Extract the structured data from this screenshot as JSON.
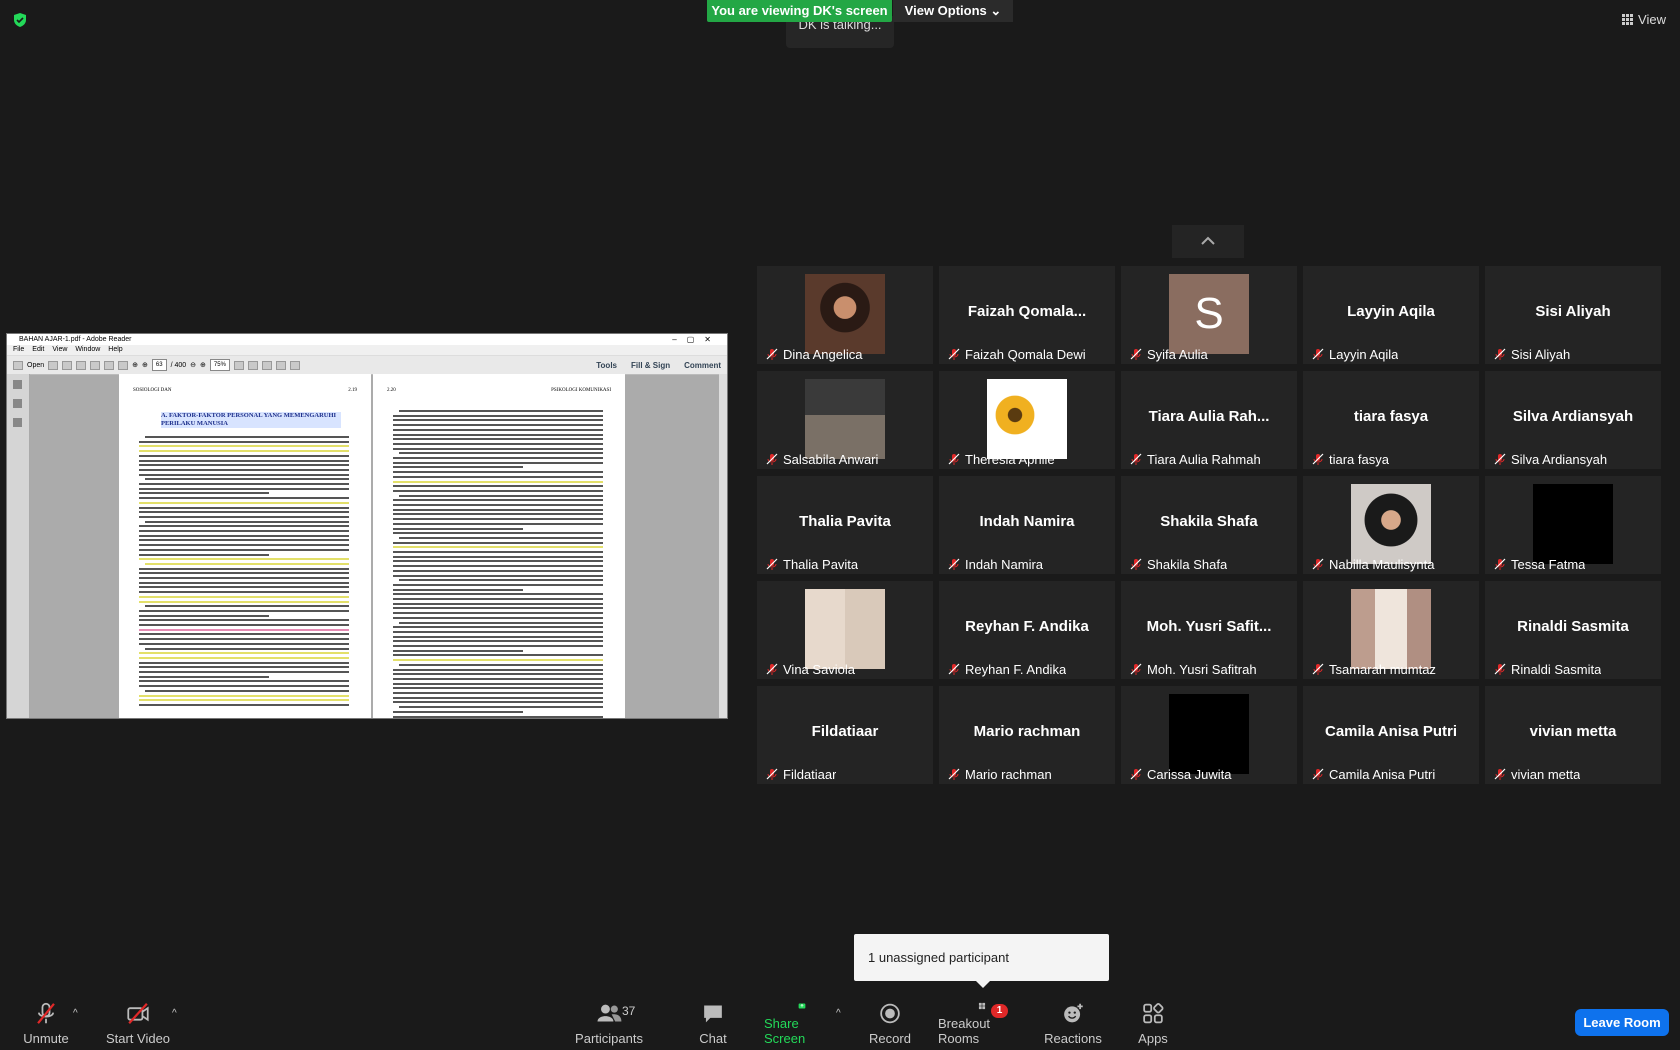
{
  "top": {
    "viewing_banner": "You are viewing DK's screen",
    "view_options": "View Options",
    "talking": "DK is talking...",
    "view_label": "View"
  },
  "pdf": {
    "title": "BAHAN AJAR-1.pdf - Adobe Reader",
    "menu": [
      "File",
      "Edit",
      "View",
      "Window",
      "Help"
    ],
    "open_label": "Open",
    "page_current": "63",
    "page_total": "/ 400",
    "zoom": "75%",
    "tools": "Tools",
    "fill_sign": "Fill & Sign",
    "comment": "Comment",
    "left_page_header": "SOSIOLOGI DAN",
    "left_page_number": "2.19",
    "right_page_number": "2.20",
    "right_page_header": "PSIKOLOGI KOMUNIKASI",
    "heading": "A. FAKTOR-FAKTOR PERSONAL YANG MEMENGARUHI PERILAKU MANUSIA"
  },
  "participants": [
    {
      "name": "Dina Angelica",
      "display": "",
      "avatar": "photo-woman"
    },
    {
      "name": "Faizah Qomala Dewi",
      "display": "Faizah Qomala...",
      "avatar": ""
    },
    {
      "name": "Syifa Aulia",
      "display": "",
      "avatar": "letter",
      "letter": "S"
    },
    {
      "name": "Layyin Aqila",
      "display": "Layyin Aqila",
      "avatar": ""
    },
    {
      "name": "Sisi Aliyah",
      "display": "Sisi Aliyah",
      "avatar": ""
    },
    {
      "name": "Salsabila Anwari",
      "display": "",
      "avatar": "photo-street"
    },
    {
      "name": "Theresia Aprilie",
      "display": "",
      "avatar": "photo-sunflower"
    },
    {
      "name": "Tiara Aulia Rahmah",
      "display": "Tiara Aulia Rah...",
      "avatar": ""
    },
    {
      "name": "tiara fasya",
      "display": "tiara fasya",
      "avatar": ""
    },
    {
      "name": "Silva Ardiansyah",
      "display": "Silva Ardiansyah",
      "avatar": ""
    },
    {
      "name": "Thalia Pavita",
      "display": "Thalia Pavita",
      "avatar": ""
    },
    {
      "name": "Indah Namira",
      "display": "Indah Namira",
      "avatar": ""
    },
    {
      "name": "Shakila Shafa",
      "display": "Shakila Shafa",
      "avatar": ""
    },
    {
      "name": "Nabilla Maulisynta",
      "display": "",
      "avatar": "photo-hijab"
    },
    {
      "name": "Tessa Fatma",
      "display": "",
      "avatar": "black"
    },
    {
      "name": "Vina Saviola",
      "display": "",
      "avatar": "photo-collage"
    },
    {
      "name": "Reyhan F. Andika",
      "display": "Reyhan F. Andika",
      "avatar": ""
    },
    {
      "name": "Moh. Yusri Safitrah",
      "display": "Moh. Yusri Safit...",
      "avatar": ""
    },
    {
      "name": "Tsamarah mumtaz",
      "display": "",
      "avatar": "photo-room"
    },
    {
      "name": "Rinaldi Sasmita",
      "display": "Rinaldi Sasmita",
      "avatar": ""
    },
    {
      "name": "Fildatiaar",
      "display": "Fildatiaar",
      "avatar": ""
    },
    {
      "name": "Mario rachman",
      "display": "Mario rachman",
      "avatar": ""
    },
    {
      "name": "Carissa Juwita",
      "display": "",
      "avatar": "black"
    },
    {
      "name": "Camila Anisa Putri",
      "display": "Camila Anisa Putri",
      "avatar": ""
    },
    {
      "name": "vivian metta",
      "display": "vivian metta",
      "avatar": ""
    }
  ],
  "popover": {
    "unassigned": "1 unassigned participant"
  },
  "toolbar": {
    "unmute": "Unmute",
    "start_video": "Start Video",
    "participants": "Participants",
    "participants_count": "37",
    "chat": "Chat",
    "share_screen": "Share Screen",
    "record": "Record",
    "breakout_rooms": "Breakout Rooms",
    "breakout_badge": "1",
    "reactions": "Reactions",
    "apps": "Apps",
    "leave_room": "Leave Room"
  },
  "colors": {
    "banner_green": "#23a745",
    "share_green": "#23d959",
    "leave_blue": "#0e72ed",
    "muted_red": "#e02828",
    "tile_bg": "#242424"
  }
}
